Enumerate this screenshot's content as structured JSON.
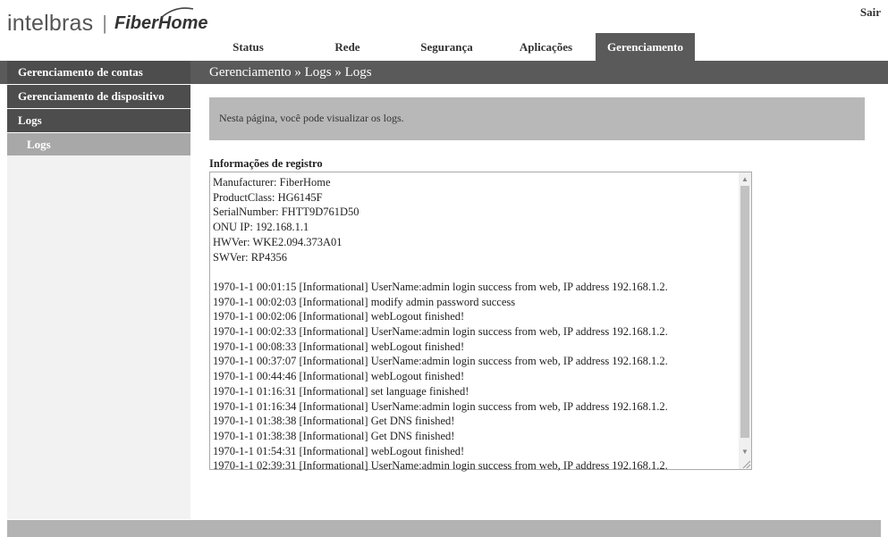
{
  "brand": {
    "logo_left": "intelbras",
    "logo_sep": "|",
    "logo_right": "FiberHome"
  },
  "header": {
    "logout_label": "Sair"
  },
  "nav": {
    "tabs": [
      {
        "label": "Status"
      },
      {
        "label": "Rede"
      },
      {
        "label": "Segurança"
      },
      {
        "label": "Aplicações"
      },
      {
        "label": "Gerenciamento",
        "active": true
      }
    ]
  },
  "sidebar": {
    "items": [
      {
        "label": "Gerenciamento de contas"
      },
      {
        "label": "Gerenciamento de dispositivo"
      },
      {
        "label": "Logs"
      }
    ],
    "sub_items": [
      {
        "label": "Logs"
      }
    ]
  },
  "main": {
    "breadcrumb": "Gerenciamento » Logs » Logs",
    "info_text": "Nesta página, você pode visualizar os logs.",
    "section_label": "Informações de registro",
    "log_lines": [
      "Manufacturer: FiberHome",
      "ProductClass: HG6145F",
      "SerialNumber: FHTT9D761D50",
      "ONU IP: 192.168.1.1",
      "HWVer: WKE2.094.373A01",
      "SWVer: RP4356",
      "",
      "1970-1-1 00:01:15 [Informational] UserName:admin login success from web, IP address 192.168.1.2.",
      "1970-1-1 00:02:03 [Informational] modify admin password success",
      "1970-1-1 00:02:06 [Informational] webLogout finished!",
      "1970-1-1 00:02:33 [Informational] UserName:admin login success from web, IP address 192.168.1.2.",
      "1970-1-1 00:08:33 [Informational] webLogout finished!",
      "1970-1-1 00:37:07 [Informational] UserName:admin login success from web, IP address 192.168.1.2.",
      "1970-1-1 00:44:46 [Informational] webLogout finished!",
      "1970-1-1 01:16:31 [Informational] set language finished!",
      "1970-1-1 01:16:34 [Informational] UserName:admin login success from web, IP address 192.168.1.2.",
      "1970-1-1 01:38:38 [Informational] Get DNS finished!",
      "1970-1-1 01:38:38 [Informational] Get DNS finished!",
      "1970-1-1 01:54:31 [Informational] webLogout finished!",
      "1970-1-1 02:39:31 [Informational] UserName:admin login success from web, IP address 192.168.1.2."
    ]
  },
  "colors": {
    "nav_active": "#5a5a5a",
    "sidebar_item": "#4d4d4d",
    "sidebar_sub": "#a8a8a8",
    "info_box": "#b8b8b8",
    "footer": "#b3b3b3"
  },
  "icons": {
    "scroll_up": "scroll-up-arrow-icon",
    "scroll_down": "scroll-down-arrow-icon",
    "resize": "resize-grip-icon"
  }
}
